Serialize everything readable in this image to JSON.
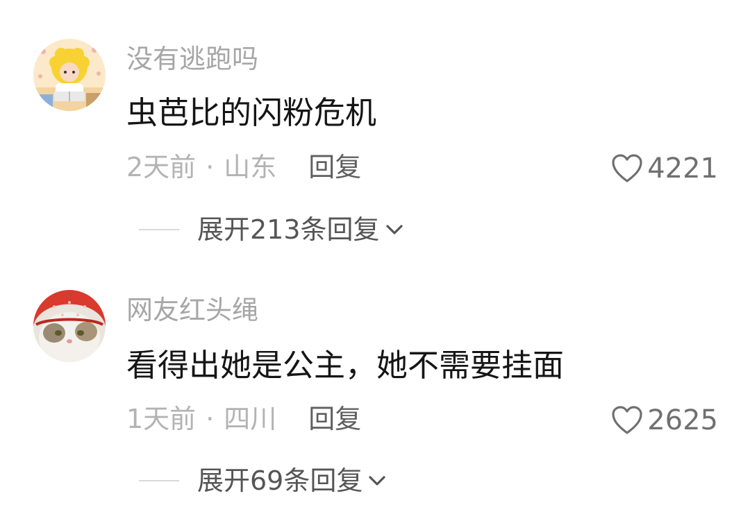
{
  "comments": [
    {
      "username": "没有逃跑吗",
      "content": "虫芭比的闪粉危机",
      "time": "2天前",
      "separator": "·",
      "location": "山东",
      "reply_label": "回复",
      "likes": "4221",
      "expand_label": "展开213条回复",
      "avatar_icon": "cartoon-girl-reading-avatar"
    },
    {
      "username": "网友红头绳",
      "content": "看得出她是公主，她不需要挂面",
      "time": "1天前",
      "separator": "·",
      "location": "四川",
      "reply_label": "回复",
      "likes": "2625",
      "expand_label": "展开69条回复",
      "avatar_icon": "cat-with-red-headscarf-avatar"
    }
  ],
  "colors": {
    "username": "#a6a6a6",
    "content": "#151515",
    "meta": "#b3b3b3",
    "reply": "#5f5f5f",
    "like": "#707070",
    "expand": "#555555"
  }
}
